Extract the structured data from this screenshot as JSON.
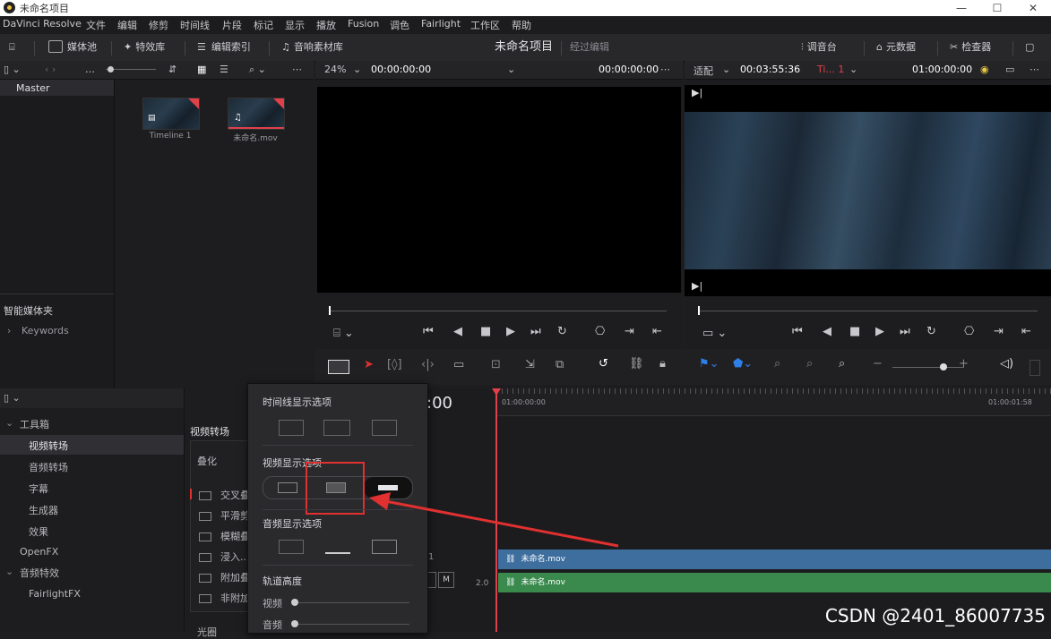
{
  "window": {
    "title": "未命名项目",
    "controls": [
      "—",
      "☐",
      "✕"
    ]
  },
  "menu": [
    "DaVinci Resolve",
    "文件",
    "编辑",
    "修剪",
    "时间线",
    "片段",
    "标记",
    "显示",
    "播放",
    "Fusion",
    "调色",
    "Fairlight",
    "工作区",
    "帮助"
  ],
  "toolbar": {
    "media_pool": "媒体池",
    "effects_library": "特效库",
    "edit_index": "编辑索引",
    "sound_library": "音响素材库",
    "project_title": "未命名项目",
    "project_subtitle": "经过编辑",
    "mixer": "调音台",
    "metadata": "元数据",
    "inspector": "检查器"
  },
  "source_viewer": {
    "zoom": "24%",
    "timecode_in": "00:00:00:00",
    "timecode_out": "00:00:00:00"
  },
  "timeline_viewer": {
    "fit": "适配",
    "duration": "00:03:55:36",
    "timeline_name": "Ti... 1",
    "timecode": "01:00:00:00"
  },
  "media_pool": {
    "bin_master": "Master",
    "clips": [
      {
        "name": "Timeline 1",
        "icon": "timeline-icon"
      },
      {
        "name": "未命名.mov",
        "icon": "music-icon"
      }
    ],
    "smart_bins": "智能媒体夹",
    "keywords": "Keywords"
  },
  "effects": {
    "toolbox": "工具箱",
    "items": [
      "视频转场",
      "音频转场",
      "字幕",
      "生成器",
      "效果"
    ],
    "openfx": "OpenFX",
    "audio_fx": "音频特效",
    "fairlight_fx": "FairlightFX",
    "list_header": "视频转场",
    "list_sub": "叠化",
    "list_items": [
      "交叉叠",
      "平滑剪",
      "模糊叠",
      "浸入...",
      "附加叠",
      "非附加"
    ],
    "footer": "光圈"
  },
  "popup": {
    "timeline_display": "时间线显示选项",
    "video_display": "视频显示选项",
    "audio_display": "音频显示选项",
    "track_height": "轨道高度",
    "video_label": "视频",
    "audio_label": "音频"
  },
  "timeline": {
    "timecode_partial": ":00",
    "ruler_start": "01:00:00:00",
    "ruler_end": "01:00:01:58",
    "video_clip": "未命名.mov",
    "audio_clip": "未命名.mov",
    "audio_level": "2.0",
    "mute_label": "M",
    "track_label": "1"
  },
  "watermark": "CSDN @2401_86007735",
  "colors": {
    "video_clip": "#3e6e9e",
    "audio_clip": "#3a8a4e",
    "playhead": "#e0404a",
    "highlight": "#e03030"
  }
}
